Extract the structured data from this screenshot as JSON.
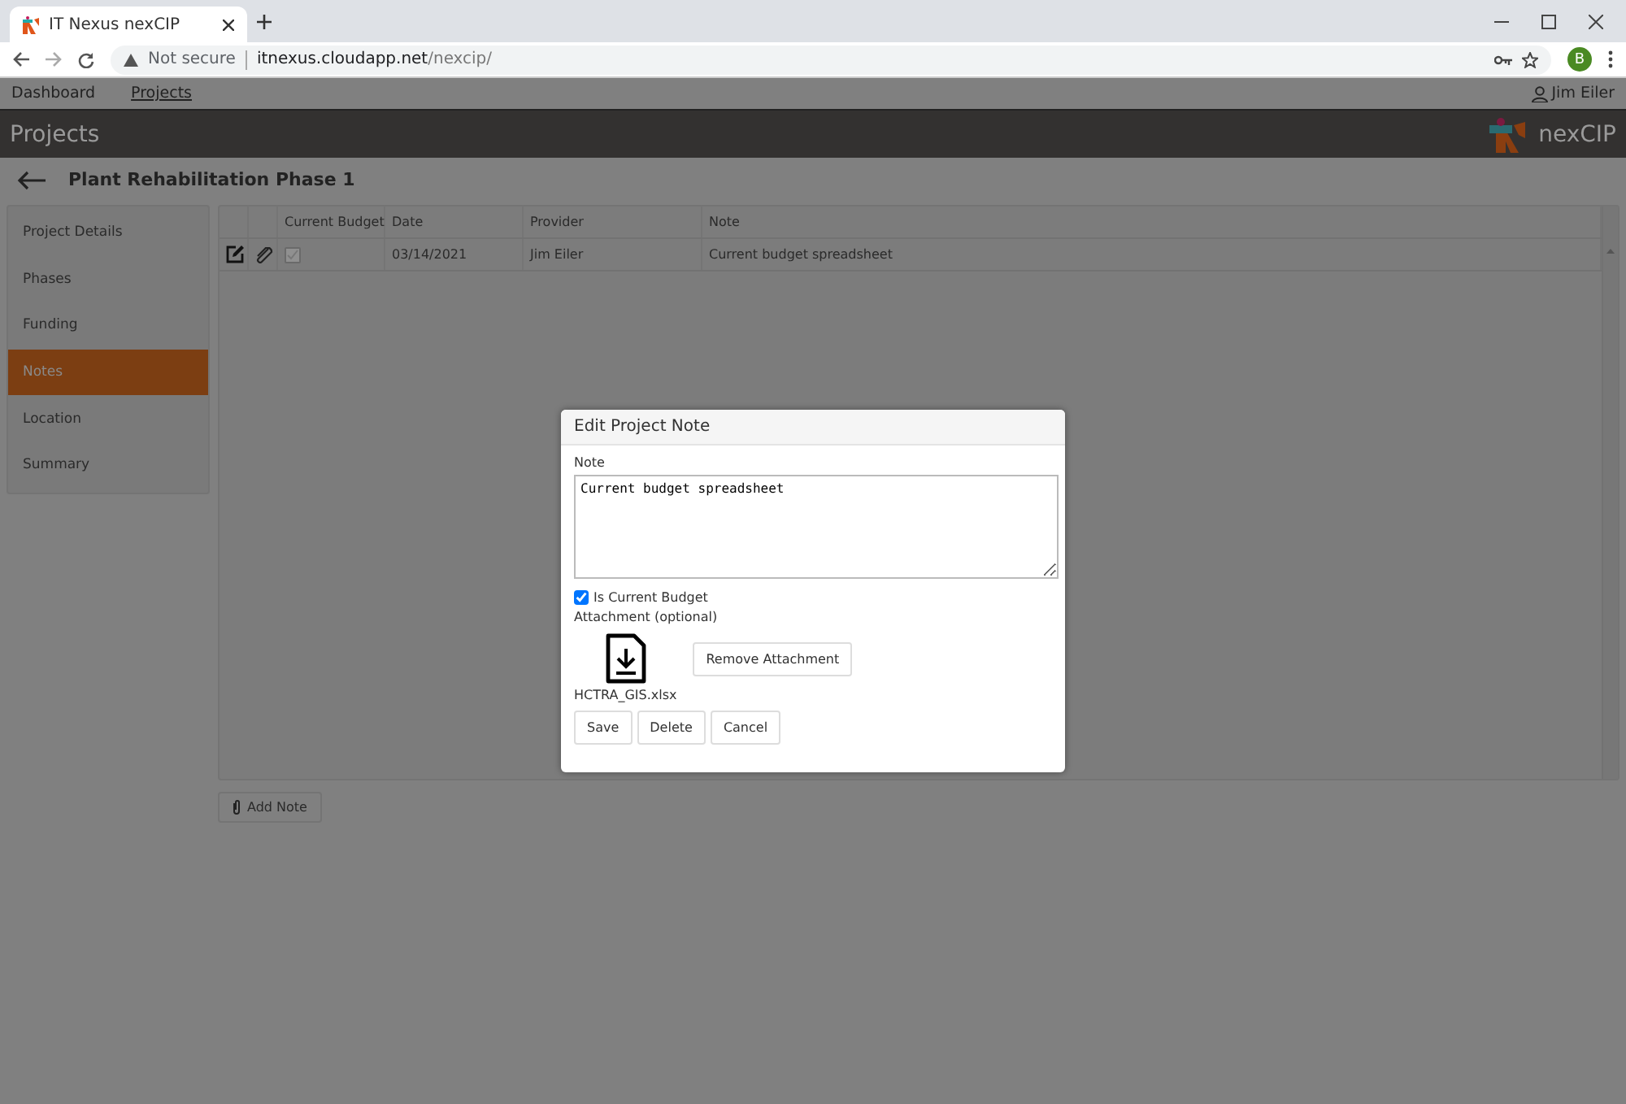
{
  "browser": {
    "tab_title": "IT Nexus nexCIP",
    "security": "Not secure",
    "url_host": "itnexus.cloudapp.net",
    "url_path": "/nexcip/",
    "profile_initial": "B"
  },
  "nav": [
    {
      "label": "Dashboard",
      "selected": false
    },
    {
      "label": "Projects",
      "selected": true
    }
  ],
  "user": "Jim Eiler",
  "header": {
    "title": "Projects",
    "brand": "nexCIP"
  },
  "project_title": "Plant Rehabilitation Phase 1",
  "sidebar": {
    "items": [
      {
        "label": "Project Details",
        "selected": false
      },
      {
        "label": "Phases",
        "selected": false
      },
      {
        "label": "Funding",
        "selected": false
      },
      {
        "label": "Notes",
        "selected": true
      },
      {
        "label": "Location",
        "selected": false
      },
      {
        "label": "Summary",
        "selected": false
      }
    ]
  },
  "table": {
    "columns": [
      "Current Budget",
      "Date",
      "Provider",
      "Note"
    ],
    "rows": [
      {
        "current_budget": true,
        "date": "03/14/2021",
        "provider": "Jim Eiler",
        "note": "Current budget spreadsheet"
      }
    ]
  },
  "add_button": "Add Note",
  "dialog": {
    "title": "Edit Project Note",
    "note_label": "Note",
    "note_value": "Current budget spreadsheet",
    "current_budget_label": "Is Current Budget",
    "current_budget_checked": true,
    "attachment_label": "Attachment (optional)",
    "file_name": "HCTRA_GIS.xlsx",
    "remove_button": "Remove Attachment",
    "buttons": [
      "Save",
      "Delete",
      "Cancel"
    ]
  }
}
